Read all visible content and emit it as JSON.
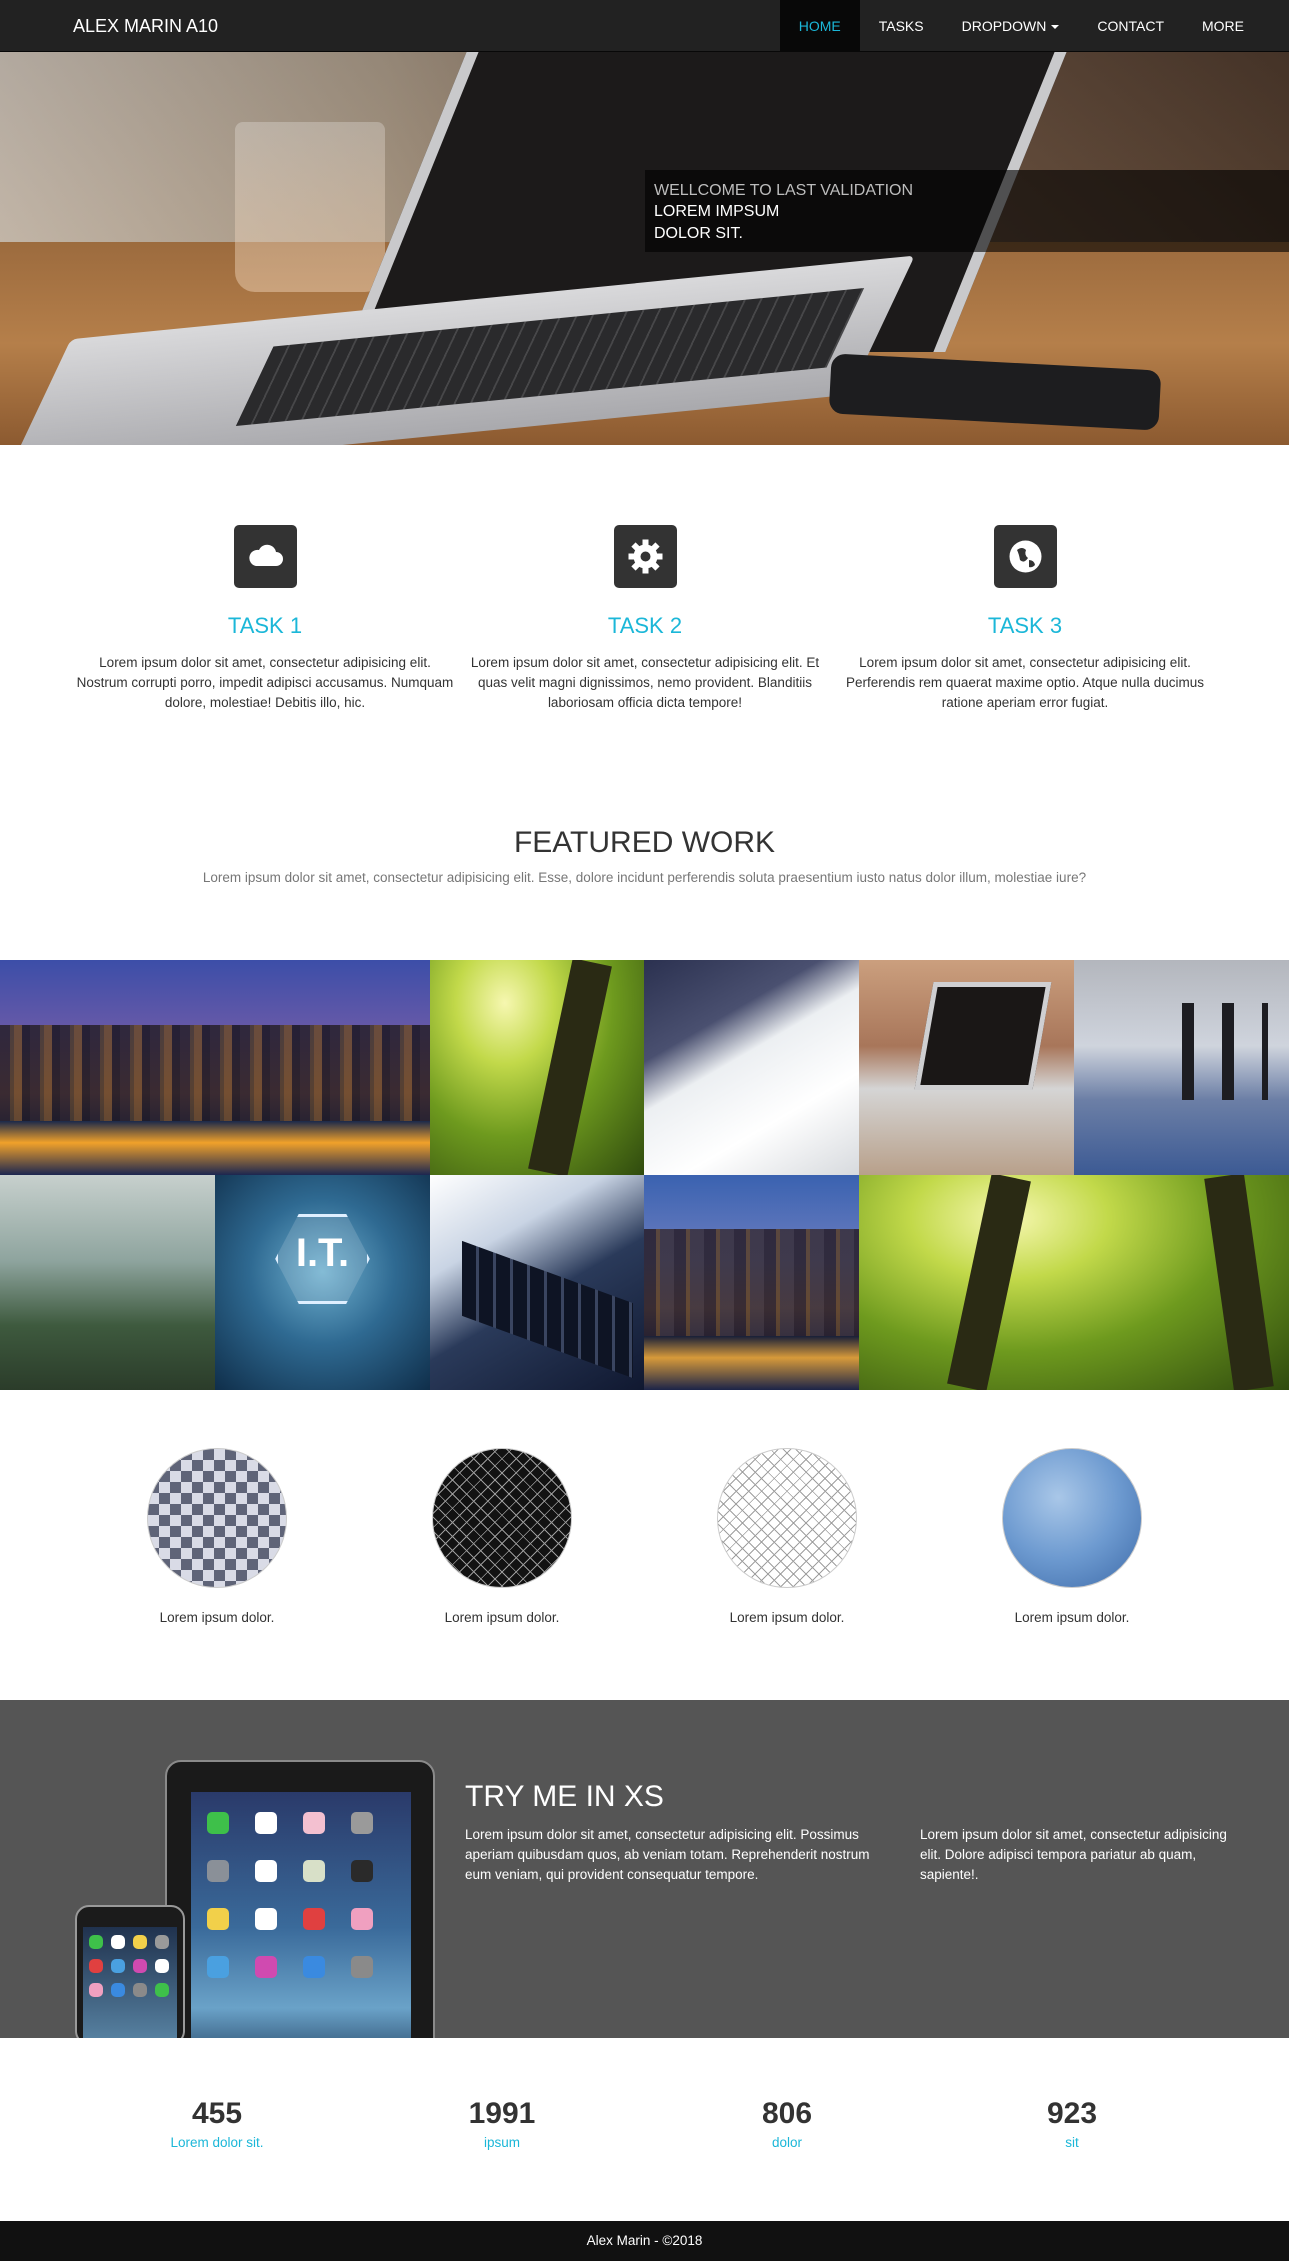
{
  "navbar": {
    "brand": "ALEX MARIN A10",
    "items": [
      {
        "label": "HOME",
        "active": true
      },
      {
        "label": "TASKS"
      },
      {
        "label": "DROPDOWN"
      },
      {
        "label": "CONTACT"
      },
      {
        "label": "MORE"
      }
    ]
  },
  "hero": {
    "caption_small": "WELLCOME TO LAST VALIDATION",
    "caption_line1": "LOREM IMPSUM",
    "caption_line2": "DOLOR SIT."
  },
  "tasks": [
    {
      "icon": "cloud-icon",
      "title": "TASK 1",
      "text": "Lorem ipsum dolor sit amet, consectetur adipisicing elit. Nostrum corrupti porro, impedit adipisci accusamus. Numquam dolore, molestiae! Debitis illo, hic."
    },
    {
      "icon": "gear-icon",
      "title": "TASK 2",
      "text": "Lorem ipsum dolor sit amet, consectetur adipisicing elit. Et quas velit magni dignissimos, nemo provident. Blanditiis laboriosam officia dicta tempore!"
    },
    {
      "icon": "globe-icon",
      "title": "TASK 3",
      "text": "Lorem ipsum dolor sit amet, consectetur adipisicing elit. Perferendis rem quaerat maxime optio. Atque nulla ducimus ratione aperiam error fugiat."
    }
  ],
  "featured": {
    "title": "FEATURED WORK",
    "subtitle": "Lorem ipsum dolor sit amet, consectetur adipisicing elit. Esse, dolore incidunt perferendis soluta praesentium iusto natus dolor illum, molestiae iure?"
  },
  "circles": [
    {
      "label": "Lorem ipsum dolor."
    },
    {
      "label": "Lorem ipsum dolor."
    },
    {
      "label": "Lorem ipsum dolor."
    },
    {
      "label": "Lorem ipsum dolor."
    }
  ],
  "tryme": {
    "title": "TRY ME IN XS",
    "col1": "Lorem ipsum dolor sit amet, consectetur adipisicing elit. Possimus aperiam quibusdam quos, ab veniam totam. Reprehenderit nostrum eum veniam, qui provident consequatur tempore.",
    "col2": "Lorem ipsum dolor sit amet, consectetur adipisicing elit. Dolore adipisci tempora pariatur ab quam, sapiente!."
  },
  "counters": [
    {
      "value": "455",
      "label": "Lorem dolor sit."
    },
    {
      "value": "1991",
      "label": "ipsum"
    },
    {
      "value": "806",
      "label": "dolor"
    },
    {
      "value": "923",
      "label": "sit"
    }
  ],
  "gallery_image_text": "I.T.",
  "footer": {
    "text": "Alex Marin - ©2018"
  },
  "colors": {
    "accent": "#1bb7d8",
    "navbar": "#222222",
    "tryme_bg": "#555555",
    "footer": "#111111"
  }
}
